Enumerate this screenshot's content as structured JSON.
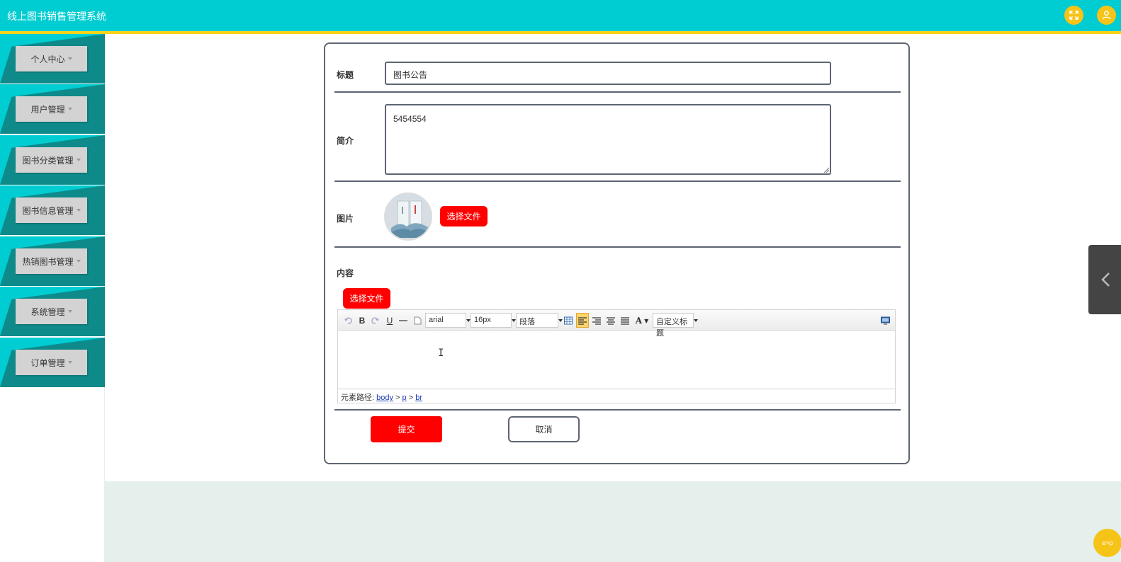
{
  "header": {
    "title": "线上图书销售管理系统",
    "accent_color": "#00cdd2",
    "line_color": "#f7d31a",
    "fullscreen_icon": "fullscreen-icon",
    "user_icon": "user-icon"
  },
  "sidebar": {
    "items": [
      {
        "label": "个人中心"
      },
      {
        "label": "用户管理"
      },
      {
        "label": "图书分类管理"
      },
      {
        "label": "图书信息管理"
      },
      {
        "label": "热销图书管理"
      },
      {
        "label": "系统管理"
      },
      {
        "label": "订单管理"
      }
    ]
  },
  "form": {
    "title_label": "标题",
    "title_value": "图书公告",
    "intro_label": "简介",
    "intro_value": "5454554",
    "image_label": "图片",
    "image_button": "选择文件",
    "content_label": "内容",
    "content_button": "选择文件",
    "submit_label": "提交",
    "cancel_label": "取消"
  },
  "editor": {
    "font_family": "arial",
    "font_size": "16px",
    "paragraph": "段落",
    "custom_heading": "自定义标题",
    "path_label": "元素路径:",
    "path": [
      "body",
      "p",
      "br"
    ],
    "bold": "B",
    "underline": "U",
    "font_color": "A"
  },
  "widget": {
    "label": "e>p"
  }
}
